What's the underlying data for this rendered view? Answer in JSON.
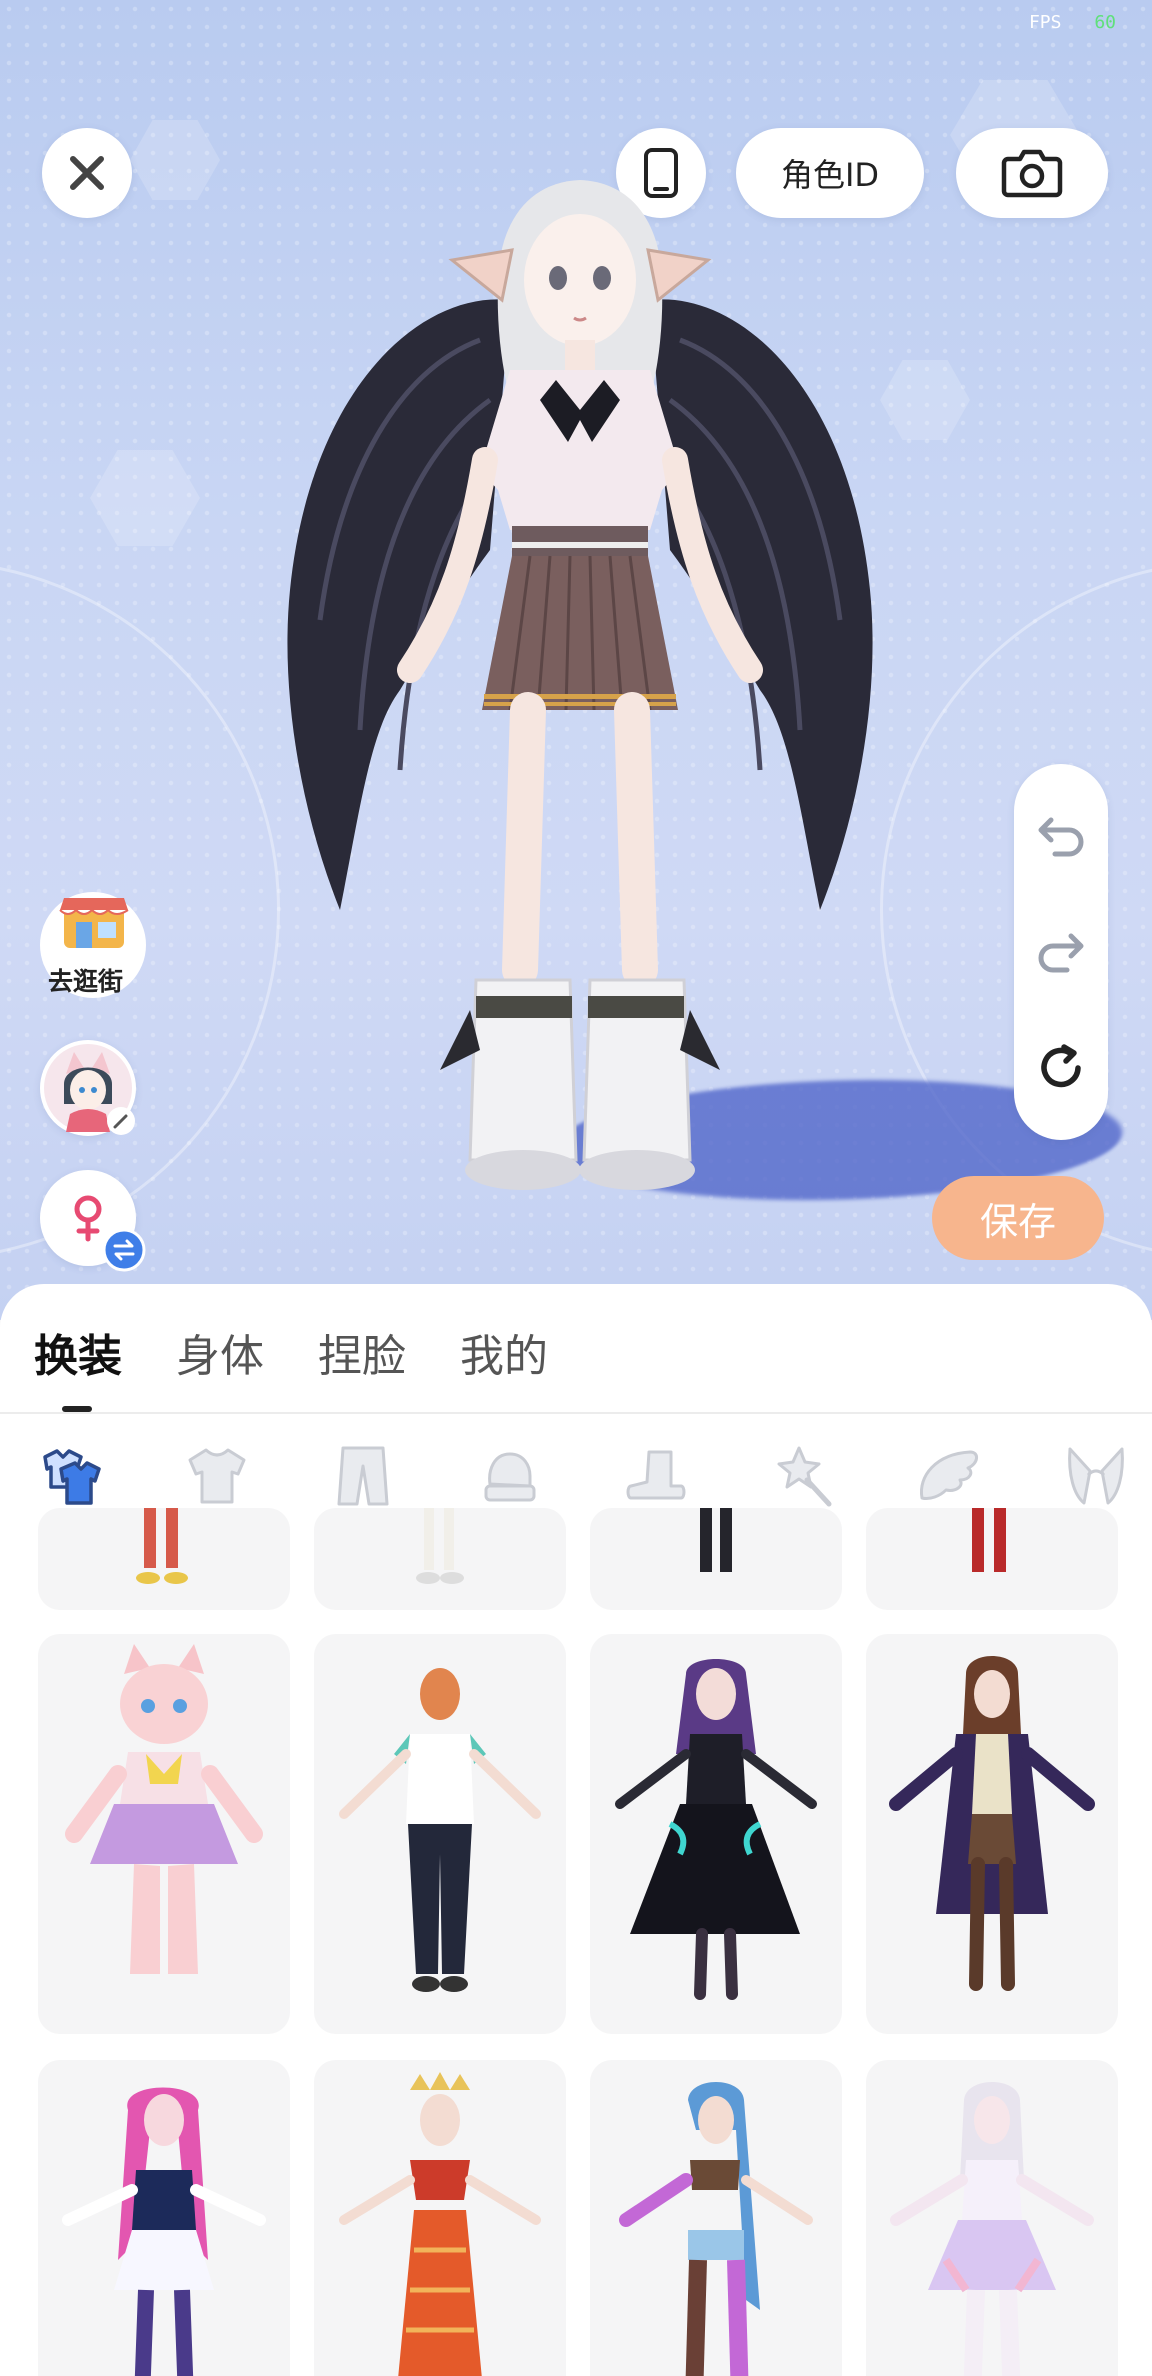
{
  "status": {
    "fps_label": "FPS",
    "fps_value": "60"
  },
  "header": {
    "role_id_label": "角色ID"
  },
  "side": {
    "shop_label": "去逛街"
  },
  "tools": {
    "undo": "undo-icon",
    "redo": "redo-icon",
    "reset": "reset-icon"
  },
  "save_label": "保存",
  "tabs": [
    {
      "label": "换装",
      "active": true
    },
    {
      "label": "身体",
      "active": false
    },
    {
      "label": "捏脸",
      "active": false
    },
    {
      "label": "我的",
      "active": false
    }
  ],
  "categories": [
    {
      "icon": "outfit-set-icon",
      "active": true
    },
    {
      "icon": "top-icon",
      "active": false
    },
    {
      "icon": "pants-icon",
      "active": false
    },
    {
      "icon": "gloves-icon",
      "active": false
    },
    {
      "icon": "shoes-icon",
      "active": false
    },
    {
      "icon": "accessory-icon",
      "active": false
    },
    {
      "icon": "wings-icon",
      "active": false
    },
    {
      "icon": "ears-icon",
      "active": false
    }
  ],
  "colors": {
    "accent": "#2f6ed8",
    "save": "#f7b58d",
    "stage_top": "#b9cbf0"
  }
}
